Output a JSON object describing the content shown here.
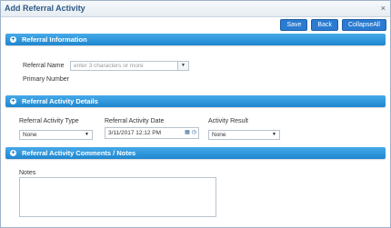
{
  "dialog": {
    "title": "Add Referral Activity",
    "close_icon": "×"
  },
  "toolbar": {
    "save_label": "Save",
    "back_label": "Back",
    "collapse_label": "CollapseAll"
  },
  "sections": {
    "referral_info": {
      "title": "Referral Information",
      "toggle_icon": "+",
      "referral_name_label": "Referral Name",
      "referral_name_placeholder": "enter 3 characters or more",
      "primary_number_label": "Primary Number"
    },
    "activity_details": {
      "title": "Referral Activity Details",
      "toggle_icon": "+",
      "type_label": "Referral Activity Type",
      "type_value": "None",
      "date_label": "Referral Activity Date",
      "date_value": "3/11/2017 12:12 PM",
      "result_label": "Activity Result",
      "result_value": "None"
    },
    "comments": {
      "title": "Referral Activity Comments / Notes",
      "toggle_icon": "+",
      "notes_label": "Notes"
    }
  },
  "colors": {
    "accent": "#1f86d0",
    "button": "#2a7bd1",
    "title_text": "#2e5a86"
  }
}
